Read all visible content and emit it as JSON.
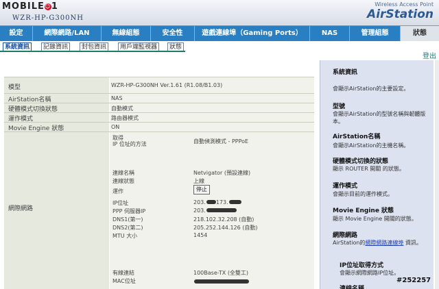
{
  "header": {
    "site_logo": "MOBILE01",
    "model": "WZR-HP-G300NH",
    "tagline": "Wireless Access Point",
    "brand": "AirStation"
  },
  "nav": {
    "tabs": [
      {
        "label": "設定"
      },
      {
        "label": "網際網路/LAN"
      },
      {
        "label": "無線組態"
      },
      {
        "label": "安全性"
      },
      {
        "label": "遊戲連線埠（Gaming Ports）"
      },
      {
        "label": "NAS"
      },
      {
        "label": "管理組態"
      },
      {
        "label": "狀態"
      }
    ]
  },
  "subnav": {
    "tabs": [
      {
        "label": "系統資訊"
      },
      {
        "label": "記錄資訊"
      },
      {
        "label": "封包資訊"
      },
      {
        "label": "用戶端監視器"
      },
      {
        "label": "狀態"
      }
    ],
    "logout": "登出"
  },
  "main": {
    "rows": [
      {
        "key": "模型",
        "value": "WZR-HP-G300NH Ver.1.61 (R1.08/B1.03)"
      },
      {
        "key": "AirStation名稱",
        "value": "NAS"
      },
      {
        "key": "硬體模式切換狀態",
        "value": "自動模式"
      },
      {
        "key": "運作模式",
        "value": "路由器模式"
      },
      {
        "key": "Movie Engine 狀態",
        "value": "ON"
      }
    ],
    "internet": {
      "key": "網際網路",
      "ip_method_label1": "取得",
      "ip_method_label2": "IP 位址的方法",
      "ip_method_value": "自動偵測模式 - PPPoE",
      "conn_name_label": "連線名稱",
      "conn_name_value": "Netvigator (預設連線)",
      "conn_status_label": "連線狀態",
      "conn_status_value": "上線",
      "action_label": "運作",
      "stop_button": "停止",
      "ip_label": "IP位址",
      "ip_value": "203.",
      "ip_value_2": "173.",
      "ppp_label": "PPP 伺服器IP",
      "ppp_value": "203.",
      "dns1_label": "DNS1(第一)",
      "dns1_value": "218.102.32.208 (自動)",
      "dns2_label": "DNS2(第二)",
      "dns2_value": "205.252.144.126 (自動)",
      "mtu_label": "MTU 大小",
      "mtu_value": "1454",
      "wired_label": "有線連結",
      "wired_value": "100Base-TX (全雙工)",
      "mac_label": "MAC位址",
      "mac_value": ""
    }
  },
  "help": {
    "items": [
      {
        "title": "系統資訊",
        "desc": "會顯示AirStation的主要設定。"
      },
      {
        "title": "型號",
        "desc": "會顯示AirStation的型號名稱與韌體版本。"
      },
      {
        "title": "AirStation名稱",
        "desc": "會顯示AirStation的主機名稱。"
      },
      {
        "title": "硬體模式切換的狀態",
        "desc": "顯示 ROUTER 開關 的狀態。"
      },
      {
        "title": "運作模式",
        "desc": "會顯示目前的運作模式。"
      },
      {
        "title": "Movie Engine 狀態",
        "desc": "顯示 Movie Engine 開關的狀態。"
      },
      {
        "title": "網際網路",
        "desc_pre": "AirStation的",
        "desc_link": "網際網路連線埠",
        "desc_post": " 資訊。"
      },
      {
        "title": "IP位址取得方式",
        "desc": "會顯示網際網路IP位址。"
      },
      {
        "title": "連線名稱",
        "desc": ""
      }
    ]
  },
  "watermark": "#252257"
}
